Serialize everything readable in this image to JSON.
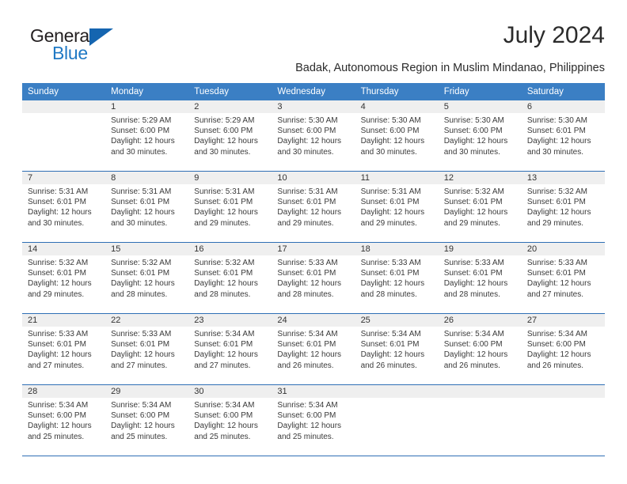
{
  "brand": {
    "name_part1": "General",
    "name_part2": "Blue",
    "accent_color": "#2079c4",
    "triangle_color": "#1565b0"
  },
  "header": {
    "title": "July 2024",
    "subtitle": "Badak, Autonomous Region in Muslim Mindanao, Philippines"
  },
  "calendar": {
    "header_bg": "#3b7fc4",
    "daynum_bg": "#efefef",
    "grid_line": "#2f6fb5",
    "weekday_headers": [
      "Sunday",
      "Monday",
      "Tuesday",
      "Wednesday",
      "Thursday",
      "Friday",
      "Saturday"
    ],
    "weeks": [
      [
        {
          "day": "",
          "sunrise": "",
          "sunset": "",
          "daylight_line1": "",
          "daylight_line2": ""
        },
        {
          "day": "1",
          "sunrise": "Sunrise: 5:29 AM",
          "sunset": "Sunset: 6:00 PM",
          "daylight_line1": "Daylight: 12 hours",
          "daylight_line2": "and 30 minutes."
        },
        {
          "day": "2",
          "sunrise": "Sunrise: 5:29 AM",
          "sunset": "Sunset: 6:00 PM",
          "daylight_line1": "Daylight: 12 hours",
          "daylight_line2": "and 30 minutes."
        },
        {
          "day": "3",
          "sunrise": "Sunrise: 5:30 AM",
          "sunset": "Sunset: 6:00 PM",
          "daylight_line1": "Daylight: 12 hours",
          "daylight_line2": "and 30 minutes."
        },
        {
          "day": "4",
          "sunrise": "Sunrise: 5:30 AM",
          "sunset": "Sunset: 6:00 PM",
          "daylight_line1": "Daylight: 12 hours",
          "daylight_line2": "and 30 minutes."
        },
        {
          "day": "5",
          "sunrise": "Sunrise: 5:30 AM",
          "sunset": "Sunset: 6:00 PM",
          "daylight_line1": "Daylight: 12 hours",
          "daylight_line2": "and 30 minutes."
        },
        {
          "day": "6",
          "sunrise": "Sunrise: 5:30 AM",
          "sunset": "Sunset: 6:01 PM",
          "daylight_line1": "Daylight: 12 hours",
          "daylight_line2": "and 30 minutes."
        }
      ],
      [
        {
          "day": "7",
          "sunrise": "Sunrise: 5:31 AM",
          "sunset": "Sunset: 6:01 PM",
          "daylight_line1": "Daylight: 12 hours",
          "daylight_line2": "and 30 minutes."
        },
        {
          "day": "8",
          "sunrise": "Sunrise: 5:31 AM",
          "sunset": "Sunset: 6:01 PM",
          "daylight_line1": "Daylight: 12 hours",
          "daylight_line2": "and 30 minutes."
        },
        {
          "day": "9",
          "sunrise": "Sunrise: 5:31 AM",
          "sunset": "Sunset: 6:01 PM",
          "daylight_line1": "Daylight: 12 hours",
          "daylight_line2": "and 29 minutes."
        },
        {
          "day": "10",
          "sunrise": "Sunrise: 5:31 AM",
          "sunset": "Sunset: 6:01 PM",
          "daylight_line1": "Daylight: 12 hours",
          "daylight_line2": "and 29 minutes."
        },
        {
          "day": "11",
          "sunrise": "Sunrise: 5:31 AM",
          "sunset": "Sunset: 6:01 PM",
          "daylight_line1": "Daylight: 12 hours",
          "daylight_line2": "and 29 minutes."
        },
        {
          "day": "12",
          "sunrise": "Sunrise: 5:32 AM",
          "sunset": "Sunset: 6:01 PM",
          "daylight_line1": "Daylight: 12 hours",
          "daylight_line2": "and 29 minutes."
        },
        {
          "day": "13",
          "sunrise": "Sunrise: 5:32 AM",
          "sunset": "Sunset: 6:01 PM",
          "daylight_line1": "Daylight: 12 hours",
          "daylight_line2": "and 29 minutes."
        }
      ],
      [
        {
          "day": "14",
          "sunrise": "Sunrise: 5:32 AM",
          "sunset": "Sunset: 6:01 PM",
          "daylight_line1": "Daylight: 12 hours",
          "daylight_line2": "and 29 minutes."
        },
        {
          "day": "15",
          "sunrise": "Sunrise: 5:32 AM",
          "sunset": "Sunset: 6:01 PM",
          "daylight_line1": "Daylight: 12 hours",
          "daylight_line2": "and 28 minutes."
        },
        {
          "day": "16",
          "sunrise": "Sunrise: 5:32 AM",
          "sunset": "Sunset: 6:01 PM",
          "daylight_line1": "Daylight: 12 hours",
          "daylight_line2": "and 28 minutes."
        },
        {
          "day": "17",
          "sunrise": "Sunrise: 5:33 AM",
          "sunset": "Sunset: 6:01 PM",
          "daylight_line1": "Daylight: 12 hours",
          "daylight_line2": "and 28 minutes."
        },
        {
          "day": "18",
          "sunrise": "Sunrise: 5:33 AM",
          "sunset": "Sunset: 6:01 PM",
          "daylight_line1": "Daylight: 12 hours",
          "daylight_line2": "and 28 minutes."
        },
        {
          "day": "19",
          "sunrise": "Sunrise: 5:33 AM",
          "sunset": "Sunset: 6:01 PM",
          "daylight_line1": "Daylight: 12 hours",
          "daylight_line2": "and 28 minutes."
        },
        {
          "day": "20",
          "sunrise": "Sunrise: 5:33 AM",
          "sunset": "Sunset: 6:01 PM",
          "daylight_line1": "Daylight: 12 hours",
          "daylight_line2": "and 27 minutes."
        }
      ],
      [
        {
          "day": "21",
          "sunrise": "Sunrise: 5:33 AM",
          "sunset": "Sunset: 6:01 PM",
          "daylight_line1": "Daylight: 12 hours",
          "daylight_line2": "and 27 minutes."
        },
        {
          "day": "22",
          "sunrise": "Sunrise: 5:33 AM",
          "sunset": "Sunset: 6:01 PM",
          "daylight_line1": "Daylight: 12 hours",
          "daylight_line2": "and 27 minutes."
        },
        {
          "day": "23",
          "sunrise": "Sunrise: 5:34 AM",
          "sunset": "Sunset: 6:01 PM",
          "daylight_line1": "Daylight: 12 hours",
          "daylight_line2": "and 27 minutes."
        },
        {
          "day": "24",
          "sunrise": "Sunrise: 5:34 AM",
          "sunset": "Sunset: 6:01 PM",
          "daylight_line1": "Daylight: 12 hours",
          "daylight_line2": "and 26 minutes."
        },
        {
          "day": "25",
          "sunrise": "Sunrise: 5:34 AM",
          "sunset": "Sunset: 6:01 PM",
          "daylight_line1": "Daylight: 12 hours",
          "daylight_line2": "and 26 minutes."
        },
        {
          "day": "26",
          "sunrise": "Sunrise: 5:34 AM",
          "sunset": "Sunset: 6:00 PM",
          "daylight_line1": "Daylight: 12 hours",
          "daylight_line2": "and 26 minutes."
        },
        {
          "day": "27",
          "sunrise": "Sunrise: 5:34 AM",
          "sunset": "Sunset: 6:00 PM",
          "daylight_line1": "Daylight: 12 hours",
          "daylight_line2": "and 26 minutes."
        }
      ],
      [
        {
          "day": "28",
          "sunrise": "Sunrise: 5:34 AM",
          "sunset": "Sunset: 6:00 PM",
          "daylight_line1": "Daylight: 12 hours",
          "daylight_line2": "and 25 minutes."
        },
        {
          "day": "29",
          "sunrise": "Sunrise: 5:34 AM",
          "sunset": "Sunset: 6:00 PM",
          "daylight_line1": "Daylight: 12 hours",
          "daylight_line2": "and 25 minutes."
        },
        {
          "day": "30",
          "sunrise": "Sunrise: 5:34 AM",
          "sunset": "Sunset: 6:00 PM",
          "daylight_line1": "Daylight: 12 hours",
          "daylight_line2": "and 25 minutes."
        },
        {
          "day": "31",
          "sunrise": "Sunrise: 5:34 AM",
          "sunset": "Sunset: 6:00 PM",
          "daylight_line1": "Daylight: 12 hours",
          "daylight_line2": "and 25 minutes."
        },
        {
          "day": "",
          "sunrise": "",
          "sunset": "",
          "daylight_line1": "",
          "daylight_line2": ""
        },
        {
          "day": "",
          "sunrise": "",
          "sunset": "",
          "daylight_line1": "",
          "daylight_line2": ""
        },
        {
          "day": "",
          "sunrise": "",
          "sunset": "",
          "daylight_line1": "",
          "daylight_line2": ""
        }
      ]
    ]
  }
}
